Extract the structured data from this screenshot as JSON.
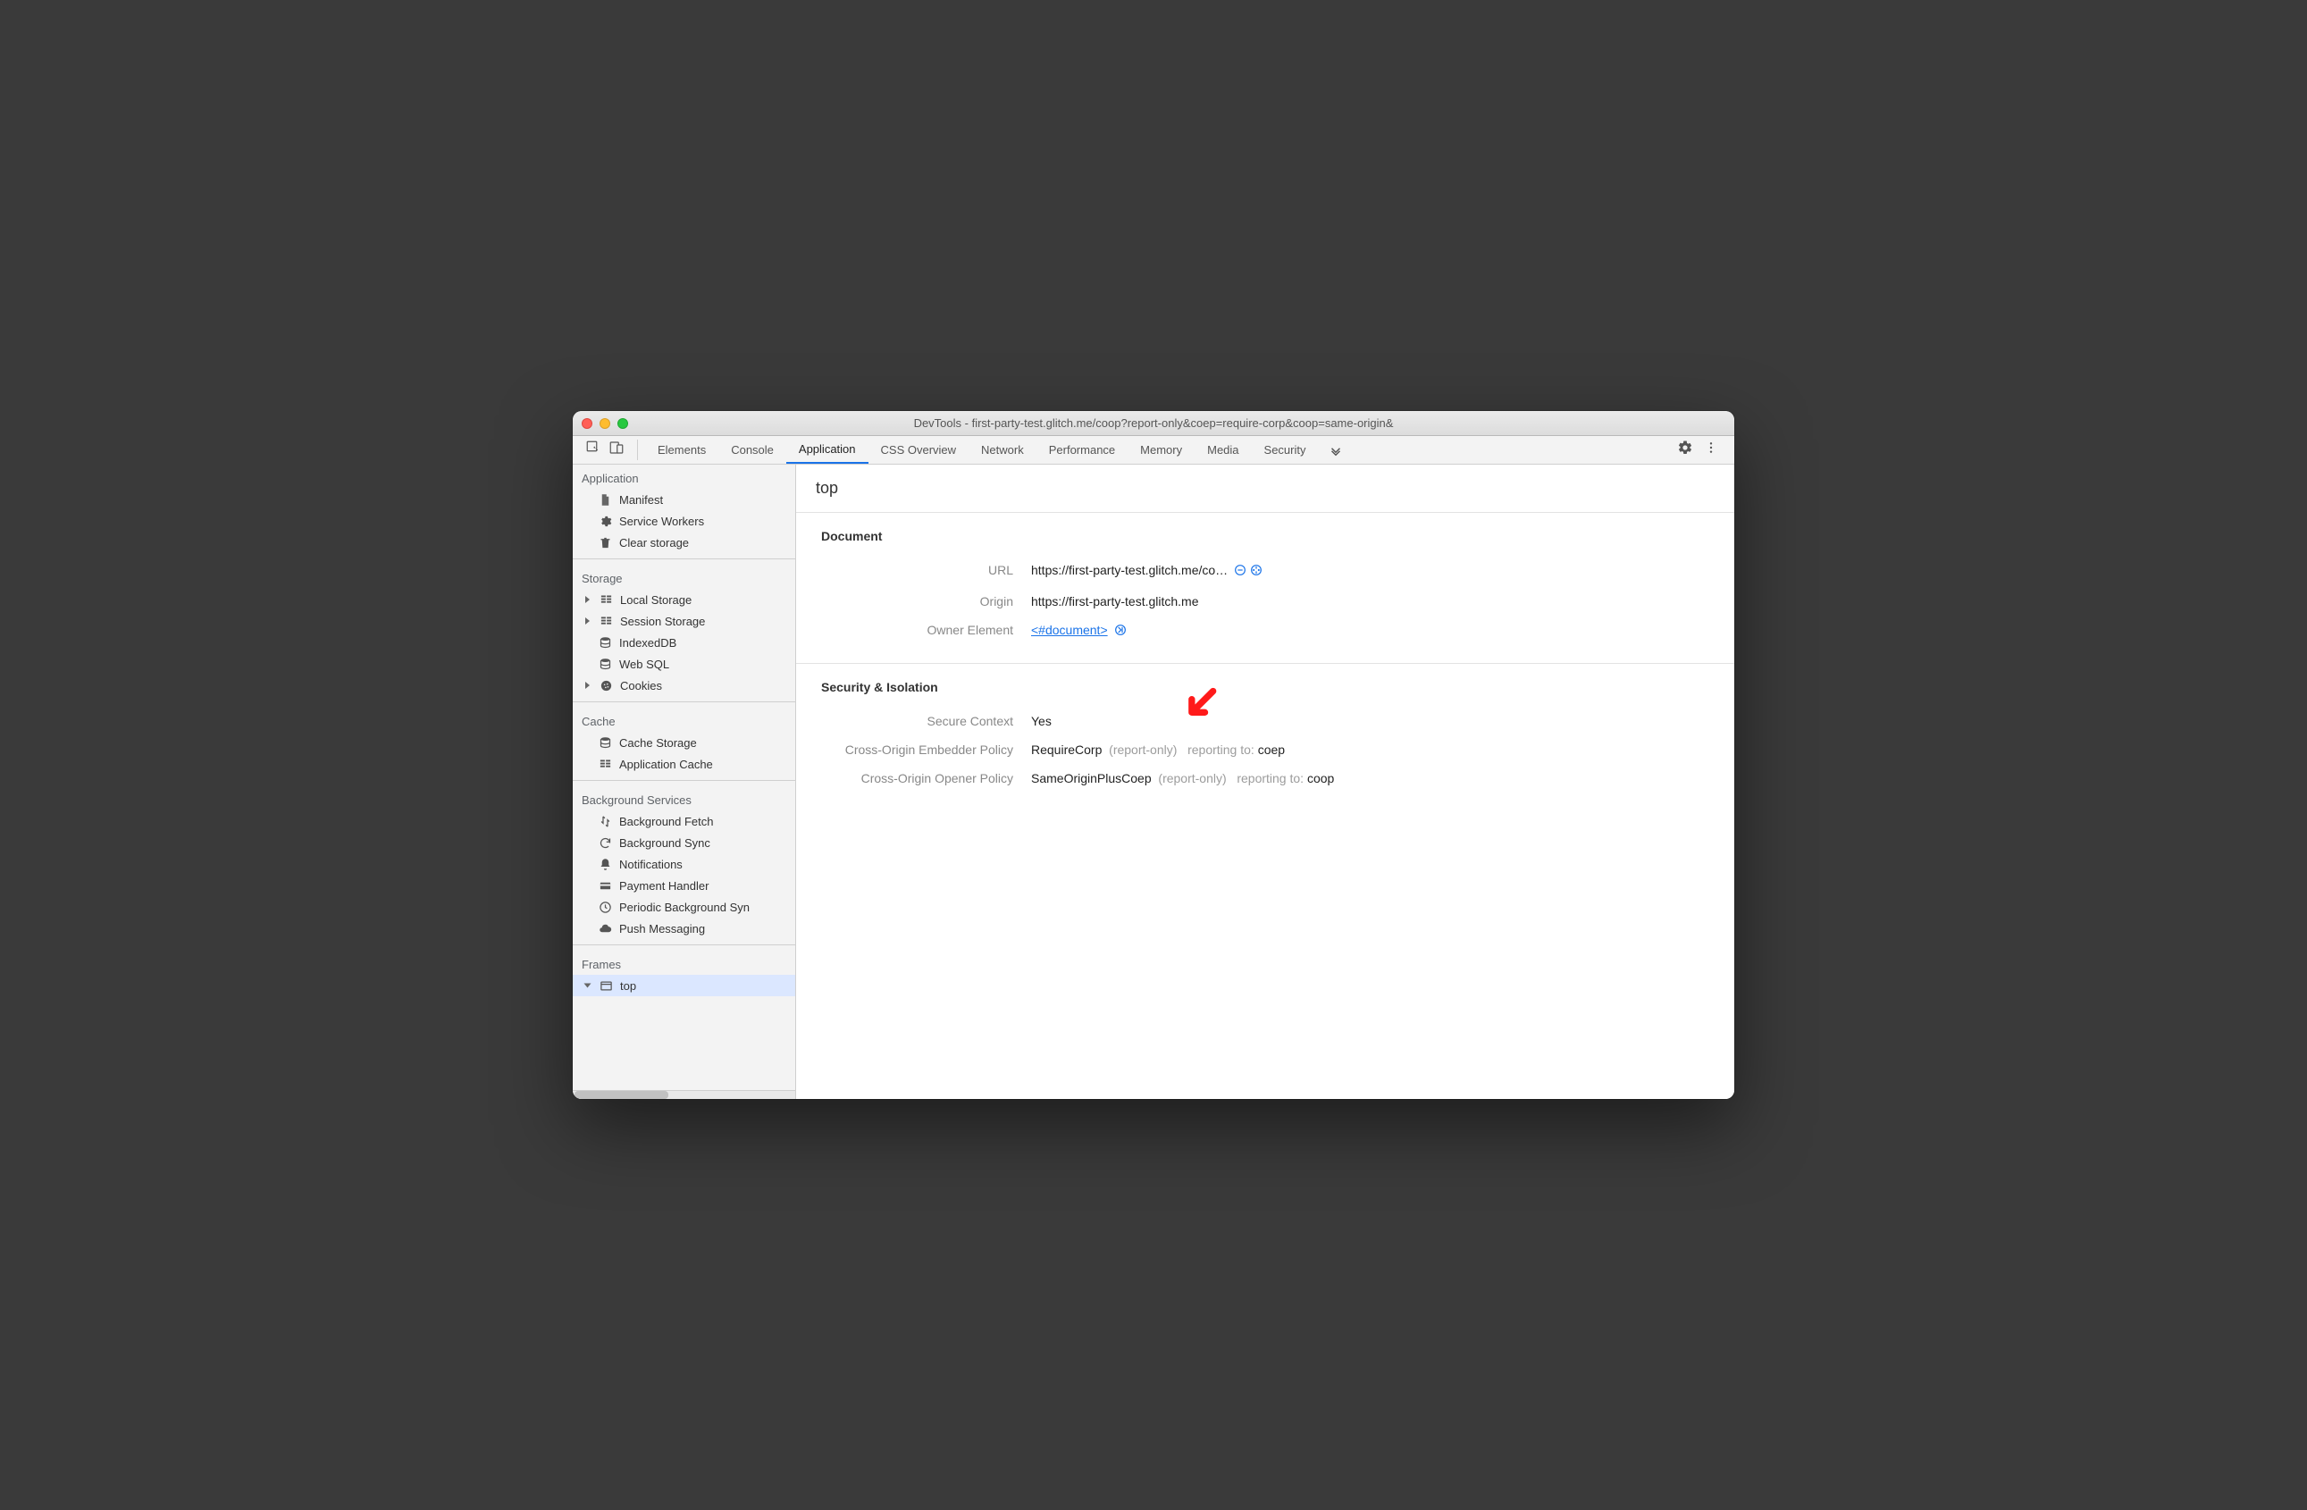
{
  "window": {
    "title": "DevTools - first-party-test.glitch.me/coop?report-only&coep=require-corp&coop=same-origin&"
  },
  "tabs": {
    "items": [
      "Elements",
      "Console",
      "Application",
      "CSS Overview",
      "Network",
      "Performance",
      "Memory",
      "Media",
      "Security"
    ],
    "active": "Application"
  },
  "sidebar": {
    "groups": [
      {
        "label": "Application",
        "items": [
          {
            "icon": "file-icon",
            "label": "Manifest"
          },
          {
            "icon": "gear-icon",
            "label": "Service Workers"
          },
          {
            "icon": "trash-icon",
            "label": "Clear storage"
          }
        ]
      },
      {
        "label": "Storage",
        "items": [
          {
            "icon": "grid-icon",
            "label": "Local Storage",
            "tree": true
          },
          {
            "icon": "grid-icon",
            "label": "Session Storage",
            "tree": true
          },
          {
            "icon": "db-icon",
            "label": "IndexedDB"
          },
          {
            "icon": "db-icon",
            "label": "Web SQL"
          },
          {
            "icon": "cookie-icon",
            "label": "Cookies",
            "tree": true
          }
        ]
      },
      {
        "label": "Cache",
        "items": [
          {
            "icon": "db-icon",
            "label": "Cache Storage"
          },
          {
            "icon": "grid-icon",
            "label": "Application Cache"
          }
        ]
      },
      {
        "label": "Background Services",
        "items": [
          {
            "icon": "updown-icon",
            "label": "Background Fetch"
          },
          {
            "icon": "sync-icon",
            "label": "Background Sync"
          },
          {
            "icon": "bell-icon",
            "label": "Notifications"
          },
          {
            "icon": "card-icon",
            "label": "Payment Handler"
          },
          {
            "icon": "clock-icon",
            "label": "Periodic Background Syn"
          },
          {
            "icon": "cloud-icon",
            "label": "Push Messaging"
          }
        ]
      },
      {
        "label": "Frames",
        "items": [
          {
            "icon": "window-icon",
            "label": "top",
            "tree": true,
            "open": true,
            "selected": true
          }
        ]
      }
    ]
  },
  "main": {
    "header": "top",
    "document": {
      "heading": "Document",
      "url_k": "URL",
      "url_v": "https://first-party-test.glitch.me/co…",
      "origin_k": "Origin",
      "origin_v": "https://first-party-test.glitch.me",
      "owner_k": "Owner Element",
      "owner_v": "<#document>"
    },
    "security": {
      "heading": "Security & Isolation",
      "ctx_k": "Secure Context",
      "ctx_v": "Yes",
      "coep_k": "Cross-Origin Embedder Policy",
      "coep_v": "RequireCorp",
      "coep_note": "(report-only)",
      "coep_rep_k": "reporting to:",
      "coep_rep_v": "coep",
      "coop_k": "Cross-Origin Opener Policy",
      "coop_v": "SameOriginPlusCoep",
      "coop_note": "(report-only)",
      "coop_rep_k": "reporting to:",
      "coop_rep_v": "coop"
    }
  }
}
